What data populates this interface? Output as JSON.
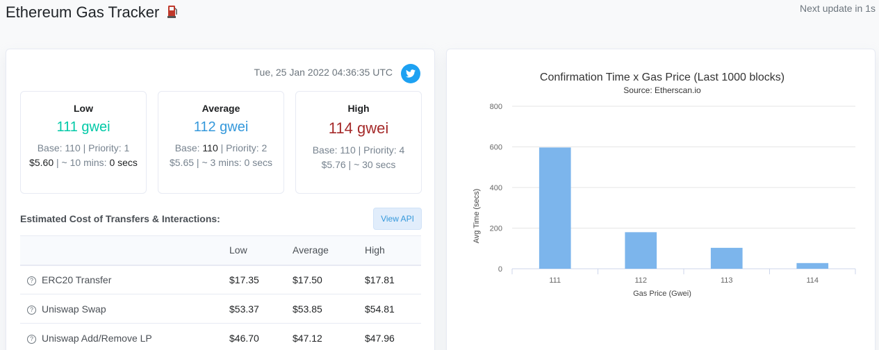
{
  "header": {
    "title": "Ethereum Gas Tracker",
    "next_update": "Next update in 1s"
  },
  "timestamp": "Tue, 25 Jan 2022 04:36:35 UTC",
  "tiers": {
    "low": {
      "label": "Low",
      "price": "111 gwei",
      "base_label": "Base:",
      "base": "110",
      "priority_label": "| Priority:",
      "priority": "1",
      "cost": "$5.60",
      "time": "| ~ 10 mins:",
      "secs": "0 secs"
    },
    "avg": {
      "label": "Average",
      "price": "112 gwei",
      "base_label": "Base:",
      "base": "110",
      "priority_label": "| Priority:",
      "priority": "2",
      "cost": "$5.65",
      "time": "| ~ 3 mins:",
      "secs": "0 secs"
    },
    "high": {
      "label": "High",
      "price": "114 gwei",
      "base_label": "Base:",
      "base": "110",
      "priority_label": "| Priority:",
      "priority": "4",
      "cost": "$5.76",
      "time": "| ~ 30 secs",
      "secs": ""
    }
  },
  "estimates": {
    "title": "Estimated Cost of Transfers & Interactions:",
    "view_api": "View API",
    "columns": [
      "",
      "Low",
      "Average",
      "High"
    ],
    "rows": [
      {
        "name": "ERC20 Transfer",
        "low": "$17.35",
        "avg": "$17.50",
        "high": "$17.81"
      },
      {
        "name": "Uniswap Swap",
        "low": "$53.37",
        "avg": "$53.85",
        "high": "$54.81"
      },
      {
        "name": "Uniswap Add/Remove LP",
        "low": "$46.70",
        "avg": "$47.12",
        "high": "$47.96"
      }
    ]
  },
  "colors": {
    "low": "#00c9a7",
    "avg": "#3498db",
    "high": "#a52a2a",
    "bar": "#7cb5ec",
    "twitter": "#1da1f2"
  },
  "icons": {
    "twitter": "twitter-icon",
    "help": "question-circle-icon",
    "pump": "fuel-pump-icon"
  },
  "chart_data": {
    "type": "bar",
    "title": "Confirmation Time x Gas Price (Last 1000 blocks)",
    "subtitle": "Source: Etherscan.io",
    "xlabel": "Gas Price (Gwei)",
    "ylabel": "Avg Time (secs)",
    "categories": [
      "111",
      "112",
      "113",
      "114"
    ],
    "values": [
      597,
      180,
      103,
      28
    ],
    "ylim": [
      0,
      800
    ],
    "yticks": [
      0,
      200,
      400,
      600,
      800
    ],
    "grid": true
  }
}
